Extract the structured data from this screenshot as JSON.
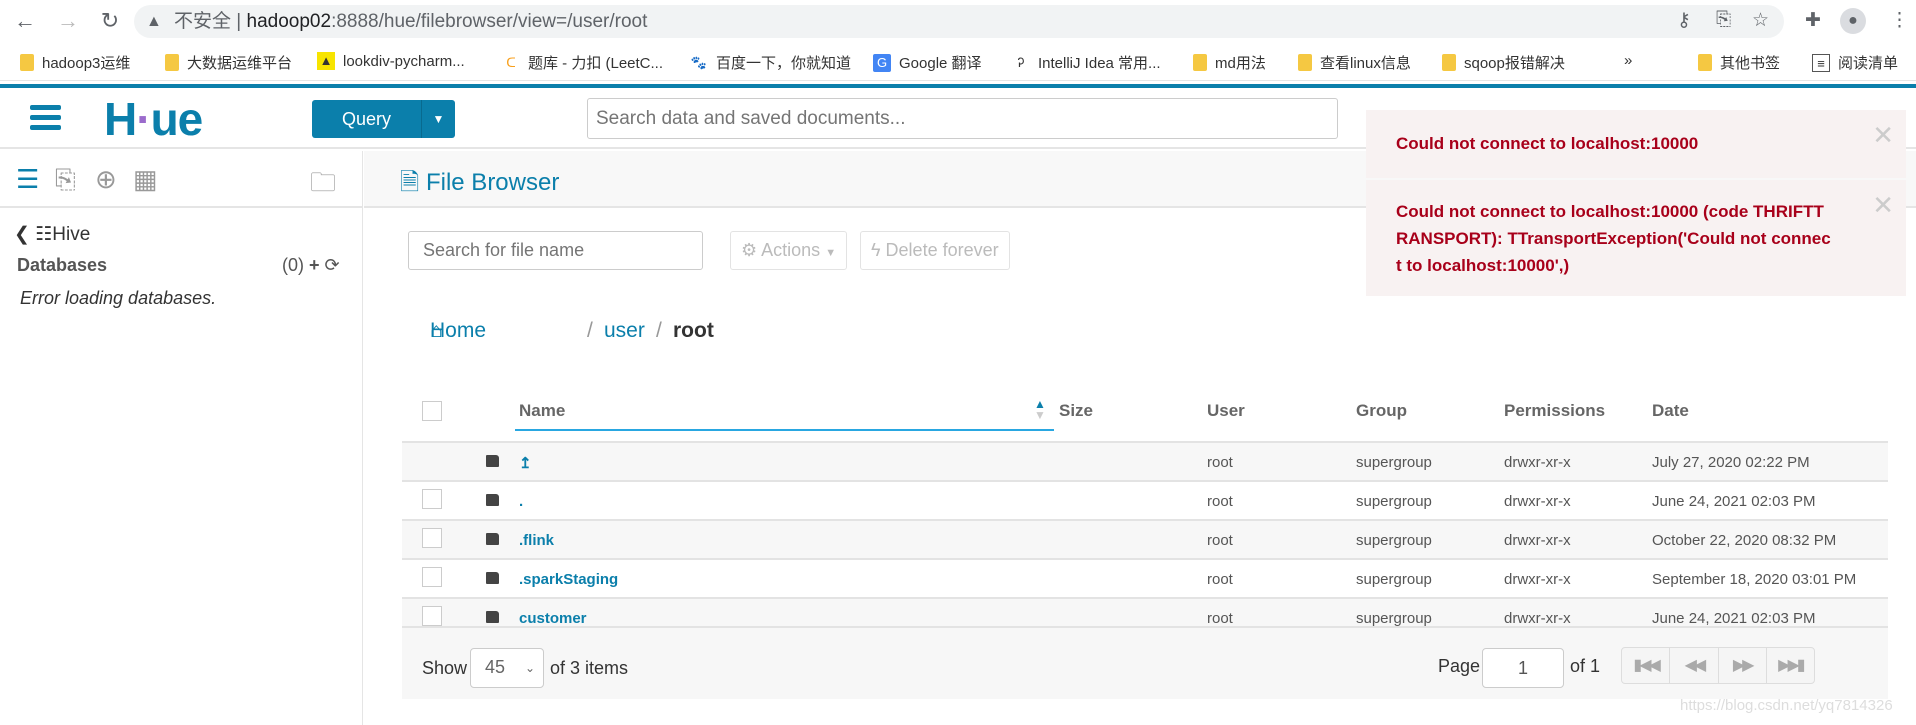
{
  "browser": {
    "security_label": "不安全",
    "url_host": "hadoop02",
    "url_rest": ":8888/hue/filebrowser/view=/user/root",
    "bookmarks": [
      {
        "label": "hadoop3运维",
        "icon": "folder"
      },
      {
        "label": "大数据运维平台",
        "icon": "folder"
      },
      {
        "label": "lookdiv-pycharm...",
        "icon": "batman"
      },
      {
        "label": "题库 - 力扣 (LeetC...",
        "icon": "leetcode"
      },
      {
        "label": "百度一下，你就知道",
        "icon": "baidu"
      },
      {
        "label": "Google 翻译",
        "icon": "google-translate"
      },
      {
        "label": "IntelliJ Idea 常用...",
        "icon": "intellij"
      },
      {
        "label": "md用法",
        "icon": "folder"
      },
      {
        "label": "查看linux信息",
        "icon": "folder"
      },
      {
        "label": "sqoop报错解决",
        "icon": "folder"
      }
    ],
    "more": "»",
    "other_bookmarks": "其他书签",
    "reading_list": "阅读清单"
  },
  "header": {
    "logo": "HUE",
    "query_label": "Query",
    "search_placeholder": "Search data and saved documents...",
    "accent": "#0b7fab"
  },
  "sidebar": {
    "source": "Hive",
    "databases_label": "Databases",
    "count": "(0)",
    "error": "Error loading databases."
  },
  "main": {
    "title": "File Browser",
    "file_search_placeholder": "Search for file name",
    "actions_label": "Actions",
    "delete_label": "Delete forever",
    "breadcrumb": {
      "home": "Home",
      "sep": "/",
      "user": "user",
      "current": "root"
    },
    "columns": [
      "Name",
      "Size",
      "User",
      "Group",
      "Permissions",
      "Date"
    ],
    "rows": [
      {
        "name": "↥",
        "size": "",
        "user": "root",
        "group": "supergroup",
        "perms": "drwxr-xr-x",
        "date": "July 27, 2020 02:22 PM"
      },
      {
        "name": ".",
        "size": "",
        "user": "root",
        "group": "supergroup",
        "perms": "drwxr-xr-x",
        "date": "June 24, 2021 02:03 PM"
      },
      {
        "name": ".flink",
        "size": "",
        "user": "root",
        "group": "supergroup",
        "perms": "drwxr-xr-x",
        "date": "October 22, 2020 08:32 PM"
      },
      {
        "name": ".sparkStaging",
        "size": "",
        "user": "root",
        "group": "supergroup",
        "perms": "drwxr-xr-x",
        "date": "September 18, 2020 03:01 PM"
      },
      {
        "name": "customer",
        "size": "",
        "user": "root",
        "group": "supergroup",
        "perms": "drwxr-xr-x",
        "date": "June 24, 2021 02:03 PM"
      }
    ],
    "footer": {
      "show": "Show",
      "page_size": "45",
      "items": "of 3 items",
      "page_label": "Page",
      "page": "1",
      "of_pages": "of 1"
    }
  },
  "alerts": [
    "Could not connect to localhost:10000",
    "Could not connect to localhost:10000 (code THRIFTTRANSPORT): TTransportException('Could not connect to localhost:10000',)"
  ],
  "watermark": "https://blog.csdn.net/yq7814326"
}
